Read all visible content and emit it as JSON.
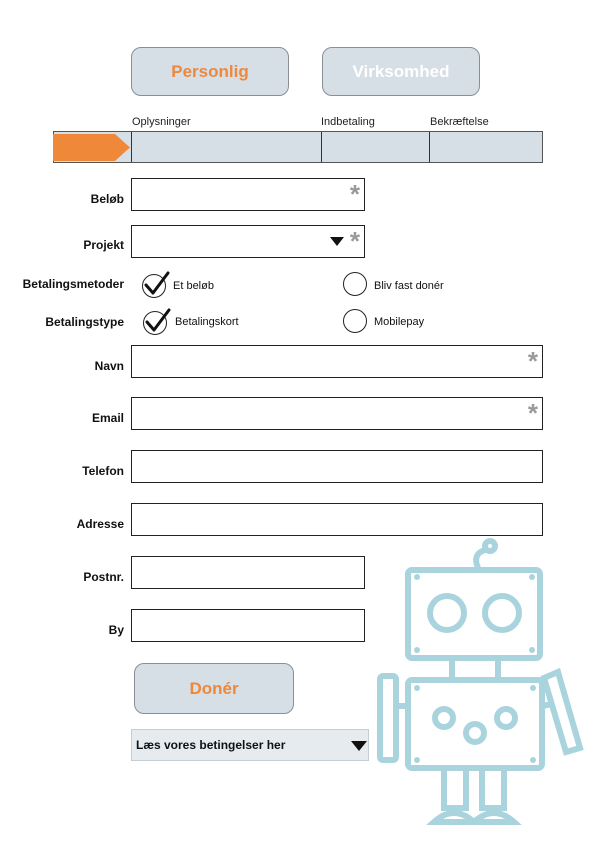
{
  "tabs": {
    "personal": "Personlig",
    "business": "Virksomhed"
  },
  "steps": [
    "Oplysninger",
    "Indbetaling",
    "Bekræftelse"
  ],
  "progress": {
    "current_step": 1,
    "total_steps": 3
  },
  "fields": {
    "amount": {
      "label": "Beløb",
      "value": "",
      "required": true
    },
    "project": {
      "label": "Projekt",
      "value": "",
      "required": true
    },
    "name": {
      "label": "Navn",
      "value": "",
      "required": true
    },
    "email": {
      "label": "Email",
      "value": "",
      "required": true
    },
    "phone": {
      "label": "Telefon",
      "value": ""
    },
    "address": {
      "label": "Adresse",
      "value": ""
    },
    "zip": {
      "label": "Postnr.",
      "value": ""
    },
    "city": {
      "label": "By",
      "value": ""
    }
  },
  "payment_methods": {
    "label": "Betalingsmetoder",
    "options": [
      "Et beløb",
      "Bliv fast donér"
    ],
    "selected": "Et beløb"
  },
  "payment_type": {
    "label": "Betalingstype",
    "options": [
      "Betalingskort",
      "Mobilepay"
    ],
    "selected": "Betalingskort"
  },
  "required_marker": "*",
  "donate_button": "Donér",
  "terms_dropdown": "Læs vores betingelser her",
  "colors": {
    "accent": "#f0883a",
    "panel": "#d6dee6",
    "robot": "#a9d4de"
  },
  "icons": [
    "arrow-marker-icon",
    "checkmark-icon",
    "dropdown-arrow-icon",
    "robot-illustration"
  ]
}
